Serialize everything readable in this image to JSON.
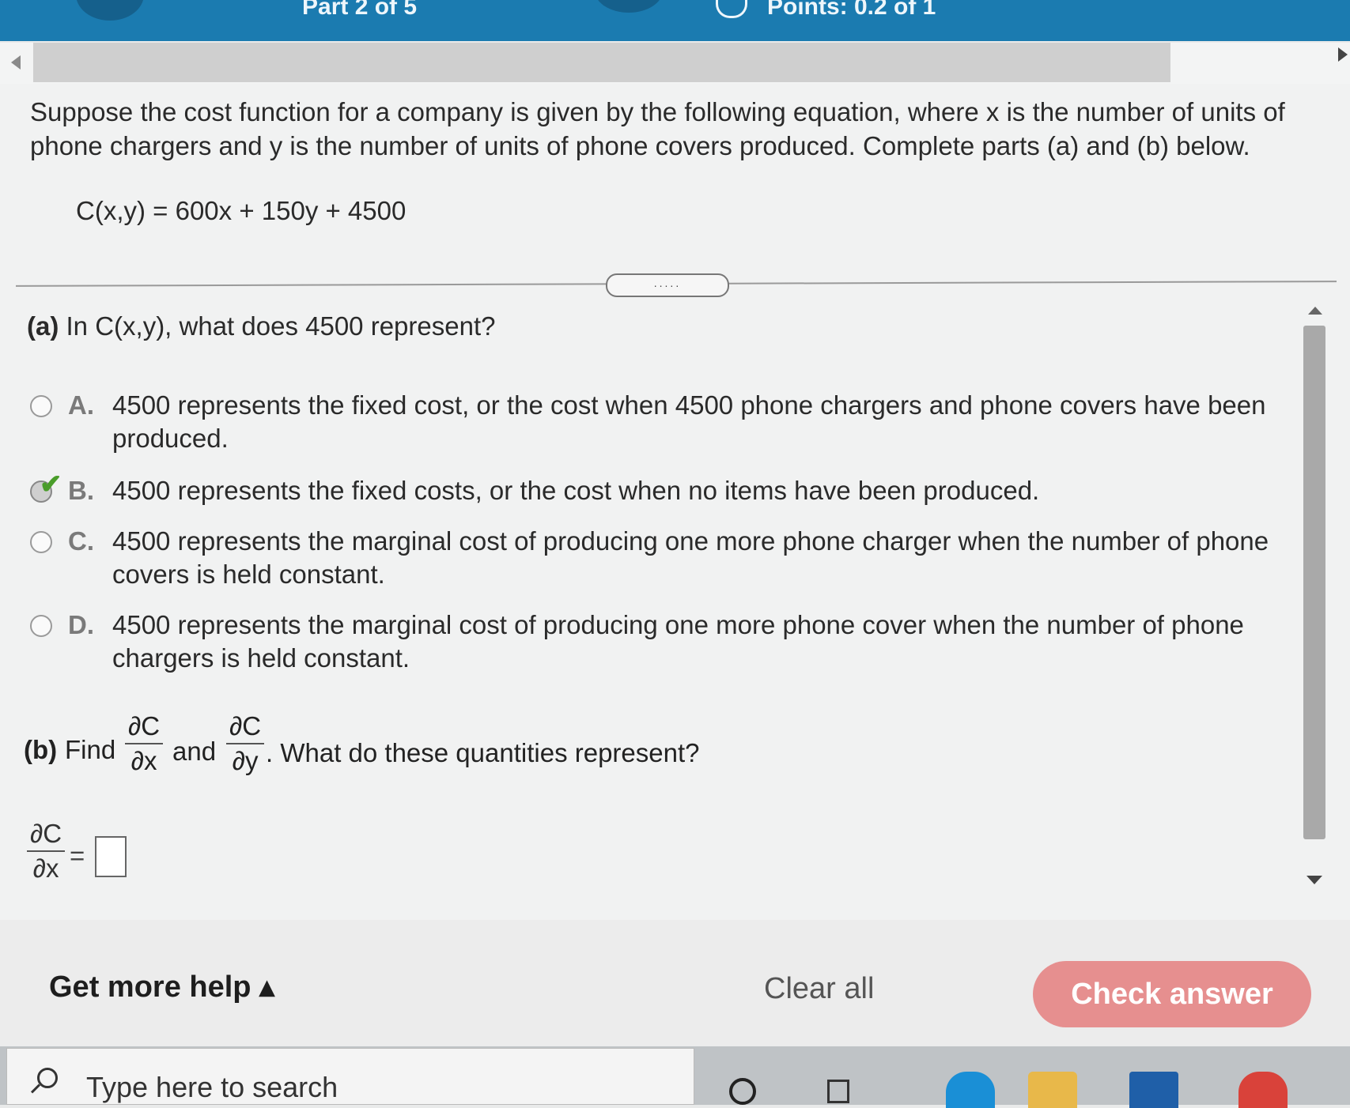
{
  "header": {
    "part_label": "Part 2 of 5",
    "points_label": "Points: 0.2 of 1"
  },
  "question": {
    "intro": "Suppose the cost function for a company is given by the following equation, where x is the number of units of phone chargers and y is the number of units of phone covers produced. Complete parts (a) and (b) below.",
    "equation": "C(x,y) = 600x + 150y + 4500",
    "divider_label": "....."
  },
  "part_a": {
    "label": "(a)",
    "prompt": "In C(x,y), what does 4500 represent?",
    "options": [
      {
        "letter": "A.",
        "text": "4500 represents the fixed cost, or the cost when 4500 phone chargers and phone covers have been produced.",
        "selected": false
      },
      {
        "letter": "B.",
        "text": "4500 represents the fixed costs, or the cost when no items have been produced.",
        "selected": true
      },
      {
        "letter": "C.",
        "text": "4500 represents the marginal cost of producing one more phone charger when the number of phone covers is held constant.",
        "selected": false
      },
      {
        "letter": "D.",
        "text": "4500 represents the marginal cost of producing one more phone cover when the number of phone chargers is held constant.",
        "selected": false
      }
    ],
    "check_mark": "✔"
  },
  "part_b": {
    "label": "(b)",
    "find": "Find",
    "and": "and",
    "rest": ". What do these quantities represent?",
    "dCdx_num": "∂C",
    "dCdx_den": "∂x",
    "dCdy_num": "∂C",
    "dCdy_den": "∂y",
    "answer_num": "∂C",
    "answer_den": "∂x",
    "equals": "="
  },
  "footer": {
    "get_more_help": "Get more help ▴",
    "clear_all": "Clear all",
    "check_answer": "Check answer"
  },
  "taskbar": {
    "search_placeholder": "Type here to search"
  },
  "colors": {
    "topbar": "#1b7bb0",
    "check_button": "#e68f8f",
    "check_mark": "#4a9d2a"
  }
}
